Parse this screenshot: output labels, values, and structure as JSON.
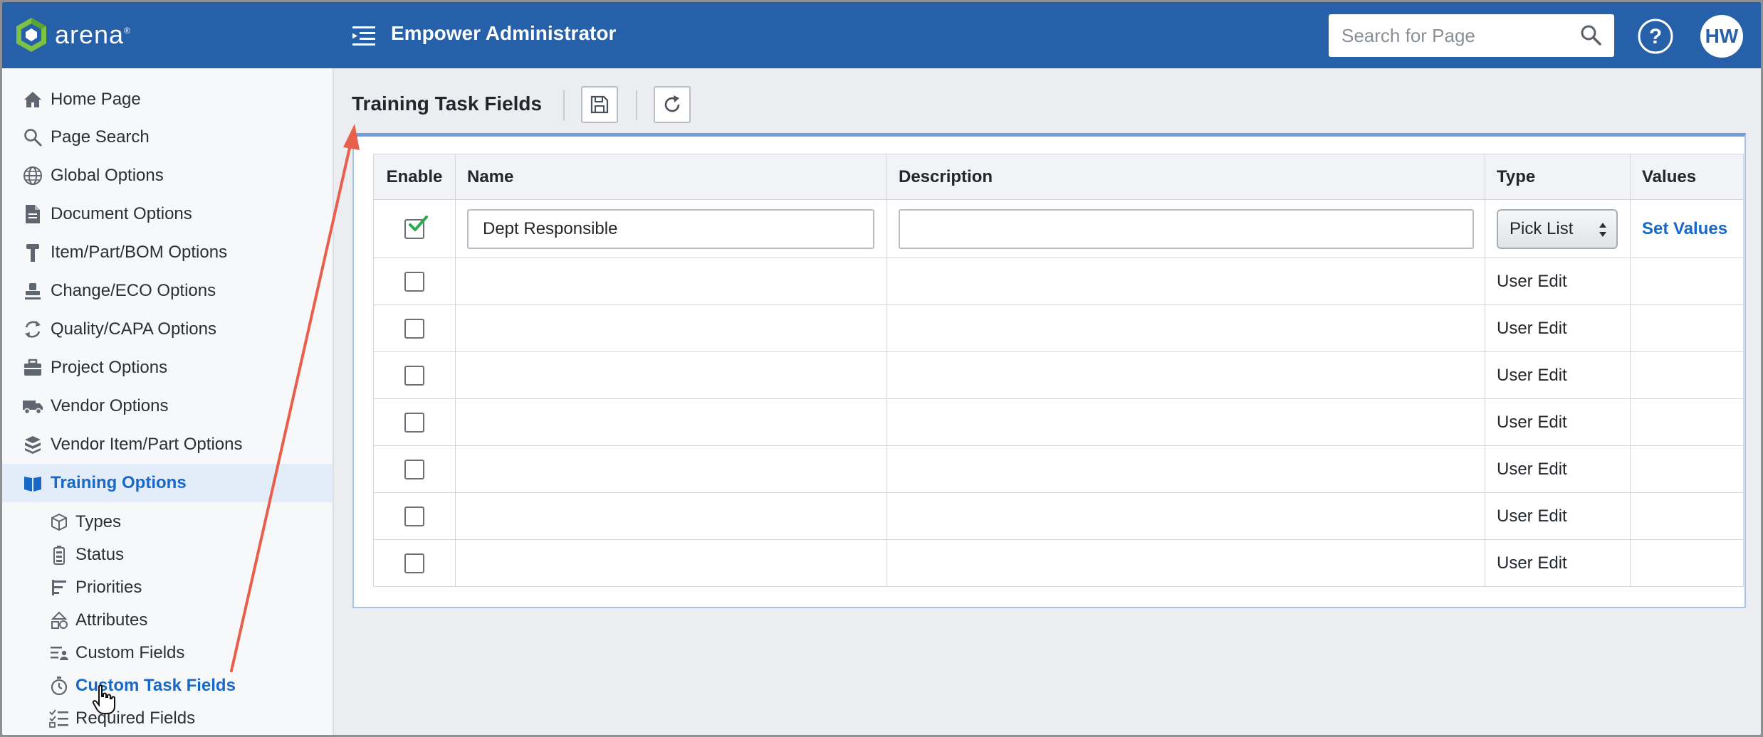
{
  "topbar": {
    "logo_text": "arena",
    "logo_mark": "®",
    "title": "Empower Administrator",
    "search_placeholder": "Search for Page",
    "user_initials": "HW",
    "brand_color": "#2660a8"
  },
  "sidebar": {
    "items": [
      {
        "label": "Home Page",
        "icon": "home-icon"
      },
      {
        "label": "Page Search",
        "icon": "search-icon"
      },
      {
        "label": "Global Options",
        "icon": "globe-icon"
      },
      {
        "label": "Document Options",
        "icon": "document-icon"
      },
      {
        "label": "Item/Part/BOM Options",
        "icon": "part-icon"
      },
      {
        "label": "Change/ECO Options",
        "icon": "stamp-icon"
      },
      {
        "label": "Quality/CAPA Options",
        "icon": "cycle-icon"
      },
      {
        "label": "Project Options",
        "icon": "briefcase-icon"
      },
      {
        "label": "Vendor Options",
        "icon": "truck-icon"
      },
      {
        "label": "Vendor Item/Part Options",
        "icon": "boxes-icon"
      },
      {
        "label": "Training Options",
        "icon": "book-icon",
        "active": true
      }
    ],
    "subitems": [
      {
        "label": "Types",
        "icon": "cube-icon"
      },
      {
        "label": "Status",
        "icon": "battery-icon"
      },
      {
        "label": "Priorities",
        "icon": "priority-icon"
      },
      {
        "label": "Attributes",
        "icon": "shapes-icon"
      },
      {
        "label": "Custom Fields",
        "icon": "custom-fields-icon"
      },
      {
        "label": "Custom Task Fields",
        "icon": "stopwatch-icon",
        "active": true
      },
      {
        "label": "Required Fields",
        "icon": "checklist-icon"
      }
    ]
  },
  "main": {
    "title": "Training Task Fields",
    "table": {
      "headers": [
        "Enable",
        "Name",
        "Description",
        "Type",
        "Values"
      ],
      "rows": [
        {
          "enabled": true,
          "name": "Dept Responsible",
          "description": "",
          "type": "Pick List",
          "values": "Set Values"
        },
        {
          "enabled": false,
          "name": "",
          "description": "",
          "type": "User Edit",
          "values": ""
        },
        {
          "enabled": false,
          "name": "",
          "description": "",
          "type": "User Edit",
          "values": ""
        },
        {
          "enabled": false,
          "name": "",
          "description": "",
          "type": "User Edit",
          "values": ""
        },
        {
          "enabled": false,
          "name": "",
          "description": "",
          "type": "User Edit",
          "values": ""
        },
        {
          "enabled": false,
          "name": "",
          "description": "",
          "type": "User Edit",
          "values": ""
        },
        {
          "enabled": false,
          "name": "",
          "description": "",
          "type": "User Edit",
          "values": ""
        },
        {
          "enabled": false,
          "name": "",
          "description": "",
          "type": "User Edit",
          "values": ""
        }
      ]
    }
  },
  "colors": {
    "active_link": "#1a68c6",
    "annotation_arrow": "#e8604c",
    "check_green": "#2fa84f"
  }
}
